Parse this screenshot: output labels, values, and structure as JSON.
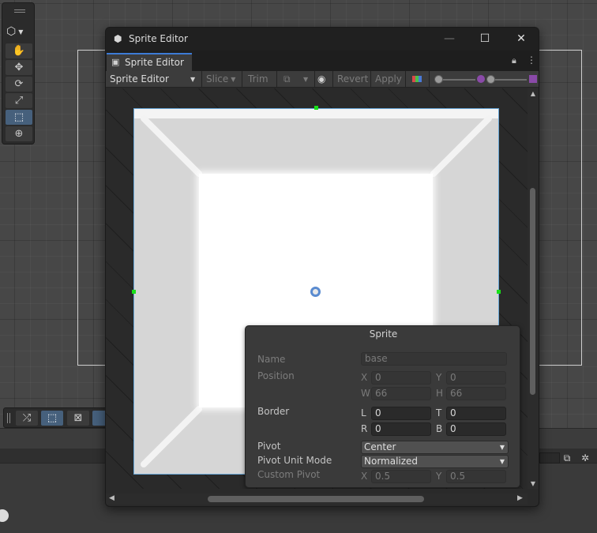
{
  "window": {
    "title": "Sprite Editor",
    "controls": {
      "minimize": "—",
      "maximize": "☐",
      "close": "✕"
    }
  },
  "tab": {
    "label": "Sprite Editor",
    "lock_icon": "lock-icon",
    "menu_icon": "kebab-menu-icon"
  },
  "toolbar": {
    "mode": "Sprite Editor",
    "slice": "Slice",
    "trim": "Trim",
    "revert": "Revert",
    "apply": "Apply",
    "icons": [
      "outline-tool-icon",
      "eye-icon",
      "color-channel-icon",
      "alpha-icon"
    ]
  },
  "sprite_panel": {
    "title": "Sprite",
    "name_label": "Name",
    "name_value": "base",
    "position_label": "Position",
    "x_label": "X",
    "x_value": "0",
    "y_label": "Y",
    "y_value": "0",
    "w_label": "W",
    "w_value": "66",
    "h_label": "H",
    "h_value": "66",
    "border_label": "Border",
    "l_label": "L",
    "l_value": "0",
    "t_label": "T",
    "t_value": "0",
    "r_label": "R",
    "r_value": "0",
    "b_label": "B",
    "b_value": "0",
    "pivot_label": "Pivot",
    "pivot_value": "Center",
    "pivot_unit_label": "Pivot Unit Mode",
    "pivot_unit_value": "Normalized",
    "custom_pivot_label": "Custom Pivot",
    "cx_label": "X",
    "cx_value": "0.5",
    "cy_label": "Y",
    "cy_value": "0.5"
  },
  "scene_tools": [
    "hand-tool-icon",
    "move-tool-icon",
    "rotate-tool-icon",
    "scale-tool-icon",
    "rect-tool-icon",
    "transform-tool-icon"
  ],
  "overlay_tools": [
    "shuffle-icon",
    "rect-select-icon",
    "sprite-shape-icon"
  ],
  "colors": {
    "accent": "#3d7bd6",
    "selected": "#46607c",
    "handle": "#19e019",
    "sprite_border": "#69a7d8"
  }
}
